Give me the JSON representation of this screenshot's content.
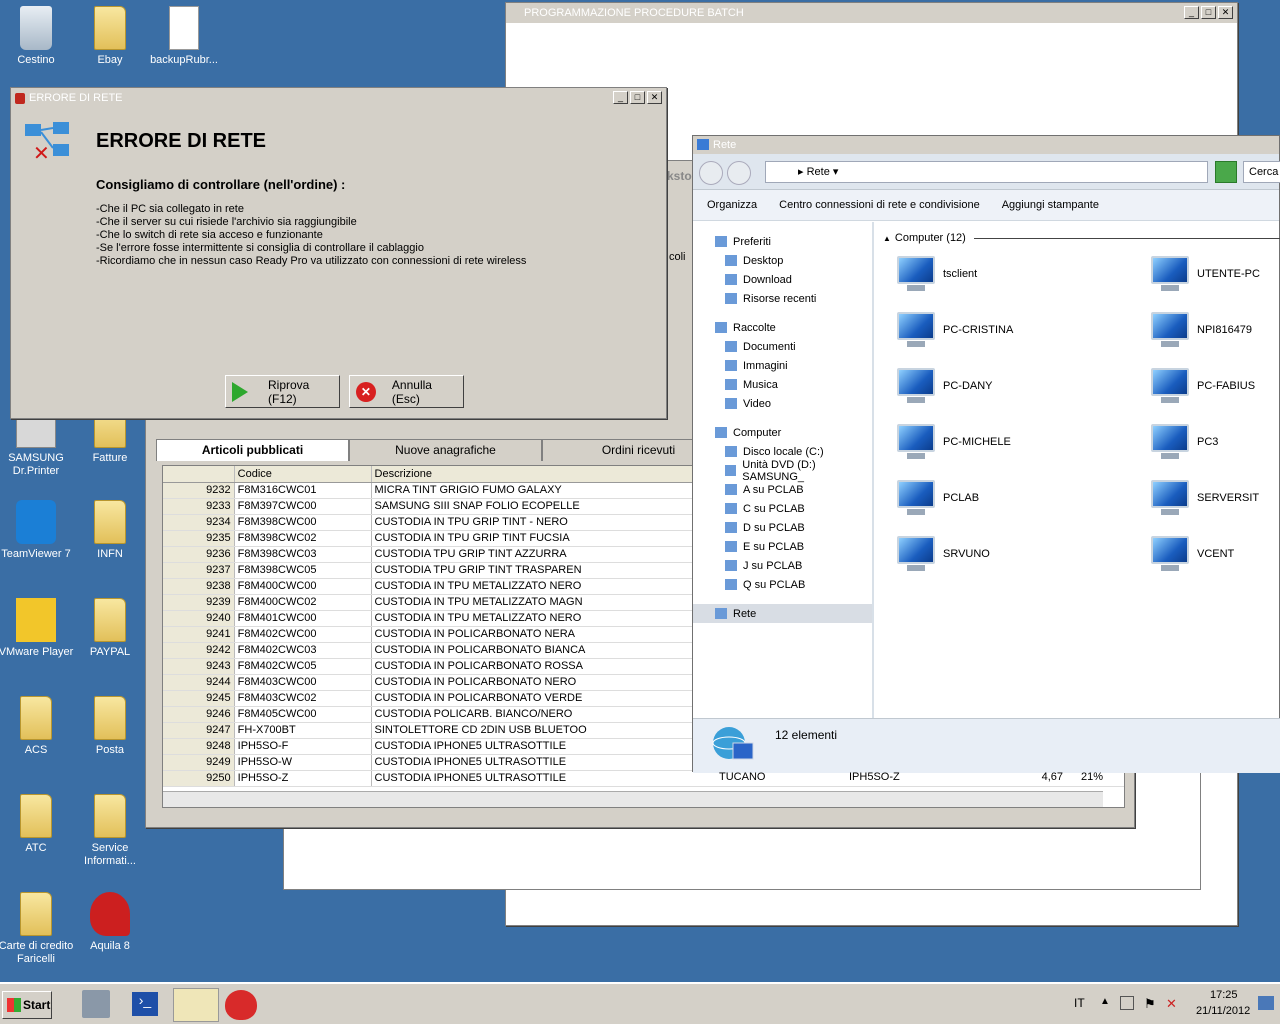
{
  "desktop_icons": [
    {
      "label": "Cestino",
      "icon": "recycle-bin-icon"
    },
    {
      "label": "Ebay",
      "icon": "folder-icon"
    },
    {
      "label": "backupRubr...",
      "icon": "file-icon"
    },
    {
      "label": "SAMSUNG Dr.Printer",
      "icon": "printer-icon"
    },
    {
      "label": "Fatture",
      "icon": "folder-icon"
    },
    {
      "label": "TeamViewer 7",
      "icon": "teamviewer-icon"
    },
    {
      "label": "INFN",
      "icon": "folder-icon"
    },
    {
      "label": "VMware Player",
      "icon": "vmware-icon"
    },
    {
      "label": "PAYPAL",
      "icon": "folder-icon"
    },
    {
      "label": "ACS",
      "icon": "folder-icon"
    },
    {
      "label": "Posta",
      "icon": "folder-icon"
    },
    {
      "label": "ATC",
      "icon": "folder-icon"
    },
    {
      "label": "Service Informati...",
      "icon": "folder-icon"
    },
    {
      "label": "Carte di credito Faricelli",
      "icon": "folder-icon"
    },
    {
      "label": "Aquila 8",
      "icon": "aquila-icon"
    }
  ],
  "batch_window": {
    "title": "PROGRAMMAZIONE PROCEDURE BATCH"
  },
  "error_dialog": {
    "title": "ERRORE DI RETE",
    "heading": "ERRORE DI RETE",
    "subheading": "Consigliamo di controllare (nell'ordine) :",
    "lines": [
      "-Che il PC sia collegato in rete",
      "-Che il server su cui risiede l'archivio sia raggiungibile",
      "-Che lo switch di rete sia acceso e funzionante",
      "-Se l'errore fosse intermittente si consiglia di controllare il cablaggio",
      "-Ricordiamo che in nessun caso Ready Pro va utilizzato con connessioni di rete wireless"
    ],
    "retry": "Riprova (F12)",
    "cancel": "Annulla (Esc)"
  },
  "background_fragments": {
    "tab_fragment": "ksto",
    "side_fragment": "coli"
  },
  "articles_window": {
    "tabs": [
      "Articoli pubblicati",
      "Nuove anagrafiche",
      "Ordini ricevuti"
    ],
    "headers": [
      "",
      "Codice",
      "Descrizione"
    ],
    "rows": [
      [
        "9232",
        "F8M316CWC01",
        "MICRA TINT GRIGIO FUMO GALAXY"
      ],
      [
        "9233",
        "F8M397CWC00",
        "SAMSUNG SIII SNAP FOLIO ECOPELLE"
      ],
      [
        "9234",
        "F8M398CWC00",
        "CUSTODIA IN TPU GRIP TINT - NERO"
      ],
      [
        "9235",
        "F8M398CWC02",
        "CUSTODIA IN TPU GRIP TINT FUCSIA"
      ],
      [
        "9236",
        "F8M398CWC03",
        "CUSTODIA TPU GRIP TINT AZZURRA"
      ],
      [
        "9237",
        "F8M398CWC05",
        "CUSTODIA TPU GRIP TINT TRASPAREN"
      ],
      [
        "9238",
        "F8M400CWC00",
        "CUSTODIA IN TPU METALIZZATO NERO"
      ],
      [
        "9239",
        "F8M400CWC02",
        "CUSTODIA IN TPU METALIZZATO MAGN"
      ],
      [
        "9240",
        "F8M401CWC00",
        "CUSTODIA IN TPU METALIZZATO NERO"
      ],
      [
        "9241",
        "F8M402CWC00",
        "CUSTODIA IN POLICARBONATO NERA"
      ],
      [
        "9242",
        "F8M402CWC03",
        "CUSTODIA IN POLICARBONATO BIANCA"
      ],
      [
        "9243",
        "F8M402CWC05",
        "CUSTODIA IN POLICARBONATO ROSSA"
      ],
      [
        "9244",
        "F8M403CWC00",
        "CUSTODIA IN POLICARBONATO NERO"
      ],
      [
        "9245",
        "F8M403CWC02",
        "CUSTODIA IN POLICARBONATO VERDE"
      ],
      [
        "9246",
        "F8M405CWC00",
        "CUSTODIA POLICARB. BIANCO/NERO"
      ],
      [
        "9247",
        "FH-X700BT",
        "SINTOLETTORE CD 2DIN USB BLUETOO"
      ],
      [
        "9248",
        "IPH5SO-F",
        "CUSTODIA IPHONE5 ULTRASOTTILE"
      ],
      [
        "9249",
        "IPH5SO-W",
        "CUSTODIA IPHONE5 ULTRASOTTILE"
      ],
      [
        "9250",
        "IPH5SO-Z",
        "CUSTODIA IPHONE5 ULTRASOTTILE"
      ]
    ],
    "row_9250_extra": {
      "brand": "TUCANO",
      "code": "IPH5SO-Z",
      "price": "4,67",
      "pct": "21%"
    }
  },
  "explorer": {
    "title": "Rete",
    "address": "Rete",
    "search_placeholder": "Cerca",
    "toolbar": [
      "Organizza",
      "Centro connessioni di rete e condivisione",
      "Aggiungi stampante"
    ],
    "nav": {
      "favorites": "Preferiti",
      "fav_items": [
        "Desktop",
        "Download",
        "Risorse recenti"
      ],
      "libraries": "Raccolte",
      "lib_items": [
        "Documenti",
        "Immagini",
        "Musica",
        "Video"
      ],
      "computer": "Computer",
      "comp_items": [
        "Disco locale (C:)",
        "Unità DVD (D:) SAMSUNG_",
        "A su PCLAB",
        "C su PCLAB",
        "D su PCLAB",
        "E su PCLAB",
        "J su PCLAB",
        "Q su PCLAB"
      ],
      "network": "Rete"
    },
    "group_label": "Computer (12)",
    "computers": [
      "tsclient",
      "UTENTE-PC",
      "PC-CRISTINA",
      "NPI816479",
      "PC-DANY",
      "PC-FABIUS",
      "PC-MICHELE",
      "PC3",
      "PCLAB",
      "SERVERSIT",
      "SRVUNO",
      "VCENT"
    ],
    "status": "12 elementi"
  },
  "taskbar": {
    "start": "Start",
    "lang": "IT",
    "time": "17:25",
    "date": "21/11/2012"
  }
}
